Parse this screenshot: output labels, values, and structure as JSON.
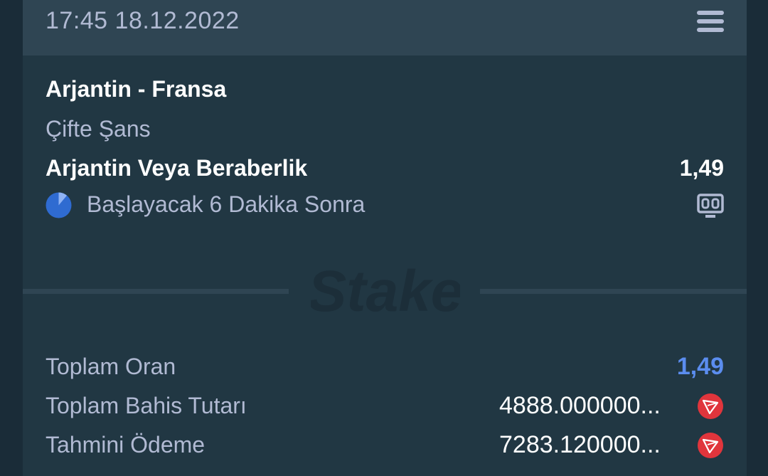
{
  "header": {
    "datetime": "17:45 18.12.2022",
    "menu_icon": "menu-icon"
  },
  "bet": {
    "match": "Arjantin - Fransa",
    "market": "Çifte Şans",
    "selection": "Arjantin Veya Beraberlik",
    "odds": "1,49",
    "status": "Başlayacak 6 Dakika Sonra",
    "status_icon": "clock-pie-icon",
    "scoreboard_icon": "scoreboard-icon"
  },
  "watermark": {
    "brand": "Stake"
  },
  "summary": {
    "total_odds_label": "Toplam Oran",
    "total_odds_value": "1,49",
    "total_stake_label": "Toplam Bahis Tutarı",
    "total_stake_value": "4888.000000...",
    "estimated_payout_label": "Tahmini Ödeme",
    "estimated_payout_value": "7283.120000...",
    "currency_icon": "tron-icon"
  },
  "colors": {
    "background": "#1a2c38",
    "card": "#213743",
    "header": "#2f4553",
    "muted_text": "#b1bad3",
    "accent_blue": "#5b8def",
    "tron_red": "#e0353c"
  }
}
